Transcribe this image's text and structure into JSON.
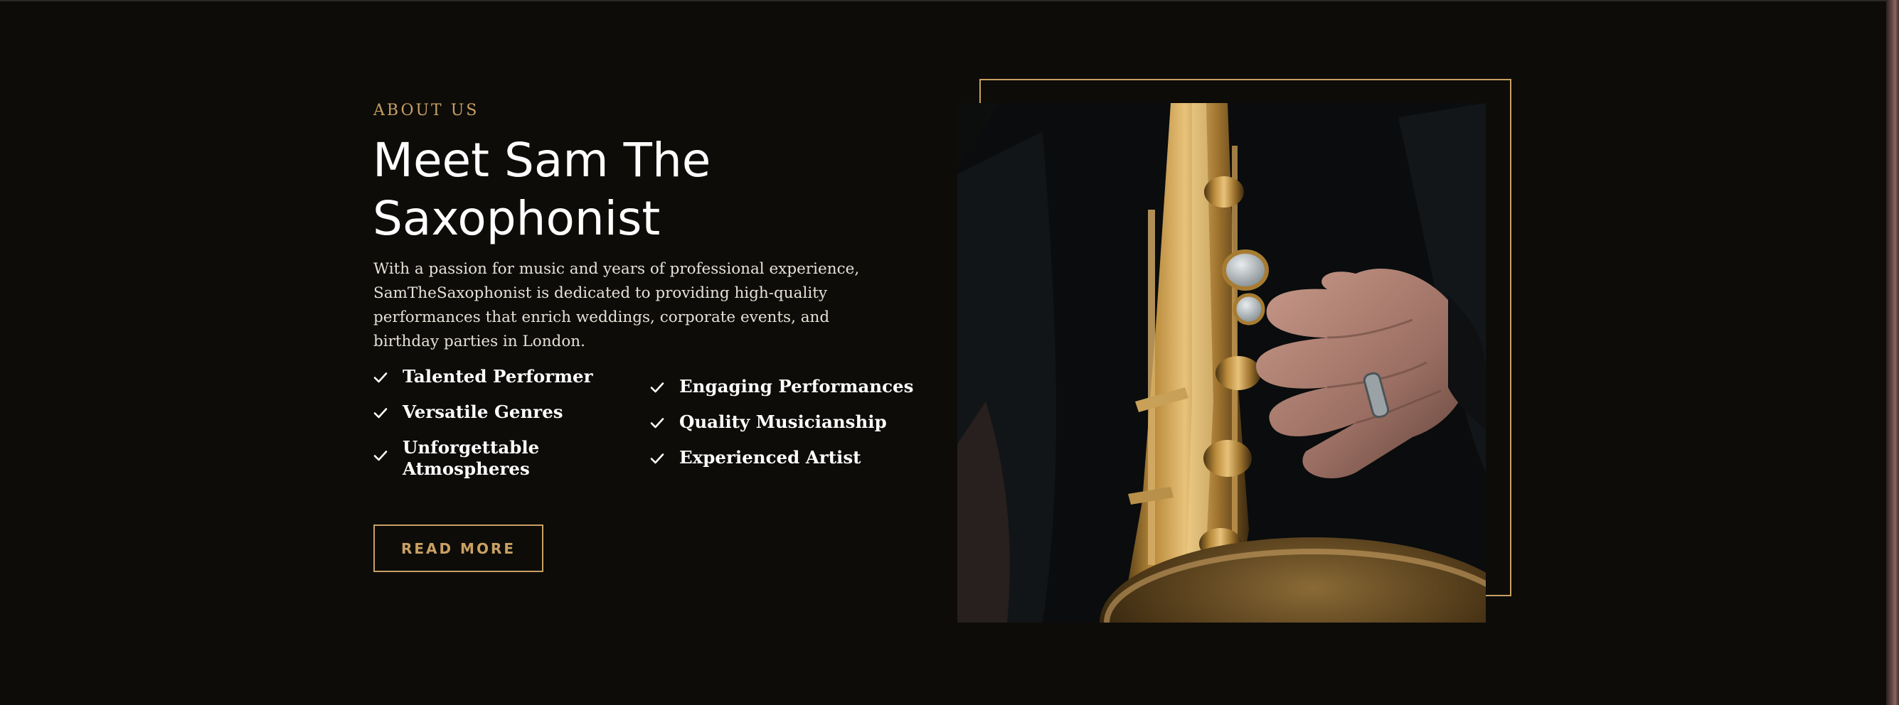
{
  "about": {
    "eyebrow": "ABOUT US",
    "title": "Meet Sam The Saxophonist",
    "description": "With a passion for music and years of professional experience, SamTheSaxophonist is dedicated to providing high-quality performances that enrich weddings, corporate events, and birthday parties in London."
  },
  "features_left": [
    {
      "label": "Talented Performer",
      "icon": "check-icon"
    },
    {
      "label": "Versatile Genres",
      "icon": "check-icon"
    },
    {
      "label": "Unforgettable Atmospheres",
      "icon": "check-icon"
    }
  ],
  "features_right": [
    {
      "label": "Engaging Performances",
      "icon": "check-icon"
    },
    {
      "label": "Quality Musicianship",
      "icon": "check-icon"
    },
    {
      "label": "Experienced Artist",
      "icon": "check-icon"
    }
  ],
  "cta": {
    "read_more_label": "READ MORE"
  },
  "colors": {
    "background": "#0d0c09",
    "accent_gold": "#c9a063",
    "heading": "#ffffff",
    "body_text": "#e6e1d7"
  }
}
